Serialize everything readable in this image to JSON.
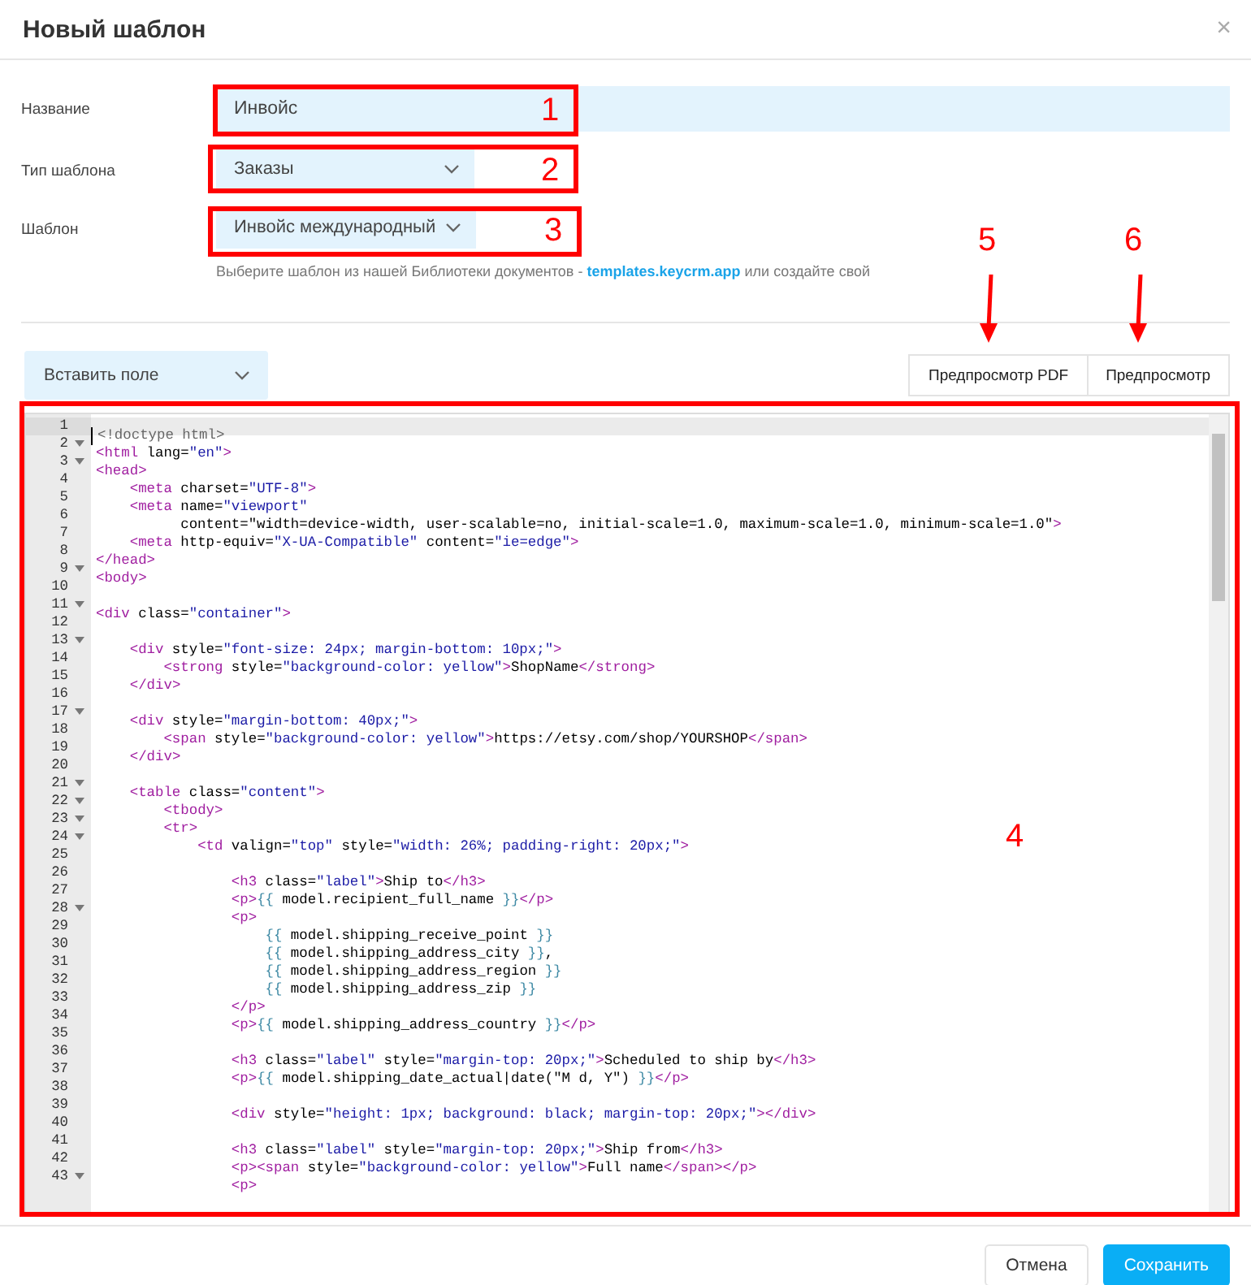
{
  "dialog": {
    "title": "Новый шаблон",
    "close": "×"
  },
  "fields": [
    {
      "kind": "text",
      "label": "Название",
      "value": "Инвойс"
    },
    {
      "kind": "select",
      "label": "Тип шаблона",
      "value": "Заказы"
    },
    {
      "kind": "select",
      "label": "Шаблон",
      "value": "Инвойс международный",
      "hint": "Выберите шаблон из нашей Библиотеки документов - ",
      "hint_link": "templates.keycrm.app",
      "hint_end": " или создайте свой"
    }
  ],
  "insert_field": "Вставить поле",
  "preview_buttons": [
    "Предпросмотр PDF",
    "Предпросмотр"
  ],
  "editor": {
    "lines": [
      {
        "number": "1",
        "text": "<!doctype html>",
        "foldable": false,
        "selected": true
      },
      {
        "number": "2",
        "text": "<html lang=\"en\">",
        "foldable": true,
        "selected": false
      },
      {
        "number": "3",
        "text": "<head>",
        "foldable": true,
        "selected": false
      },
      {
        "number": "4",
        "text": "    <meta charset=\"UTF-8\">",
        "foldable": false,
        "selected": false
      },
      {
        "number": "5",
        "text": "    <meta name=\"viewport\"",
        "foldable": false,
        "selected": false
      },
      {
        "number": "6",
        "text": "          content=\"width=device-width, user-scalable=no, initial-scale=1.0, maximum-scale=1.0, minimum-scale=1.0\">",
        "foldable": false,
        "selected": false
      },
      {
        "number": "7",
        "text": "    <meta http-equiv=\"X-UA-Compatible\" content=\"ie=edge\">",
        "foldable": false,
        "selected": false
      },
      {
        "number": "8",
        "text": "</head>",
        "foldable": false,
        "selected": false
      },
      {
        "number": "9",
        "text": "<body>",
        "foldable": true,
        "selected": false
      },
      {
        "number": "10",
        "foldable": false,
        "selected": false
      },
      {
        "number": "11",
        "text": "<div class=\"container\">",
        "foldable": true,
        "selected": false
      },
      {
        "number": "12",
        "foldable": false,
        "selected": false
      },
      {
        "number": "13",
        "text": "    <div style=\"font-size: 24px; margin-bottom: 10px;\">",
        "foldable": true,
        "selected": false
      },
      {
        "number": "14",
        "text": "        <strong style=\"background-color: yellow\">ShopName</strong>",
        "foldable": false,
        "selected": false
      },
      {
        "number": "15",
        "text": "    </div>",
        "foldable": false,
        "selected": false
      },
      {
        "number": "16",
        "foldable": false,
        "selected": false
      },
      {
        "number": "17",
        "text": "    <div style=\"margin-bottom: 40px;\">",
        "foldable": true,
        "selected": false
      },
      {
        "number": "18",
        "text": "        <span style=\"background-color: yellow\">https://etsy.com/shop/YOURSHOP</span>",
        "foldable": false,
        "selected": false
      },
      {
        "number": "19",
        "text": "    </div>",
        "foldable": false,
        "selected": false
      },
      {
        "number": "20",
        "foldable": false,
        "selected": false
      },
      {
        "number": "21",
        "text": "    <table class=\"content\">",
        "foldable": true,
        "selected": false
      },
      {
        "number": "22",
        "text": "        <tbody>",
        "foldable": true,
        "selected": false
      },
      {
        "number": "23",
        "text": "        <tr>",
        "foldable": true,
        "selected": false
      },
      {
        "number": "24",
        "text": "            <td valign=\"top\" style=\"width: 26%; padding-right: 20px;\">",
        "foldable": true,
        "selected": false
      },
      {
        "number": "25",
        "foldable": false,
        "selected": false
      },
      {
        "number": "26",
        "text": "                <h3 class=\"label\">Ship to</h3>",
        "foldable": false,
        "selected": false
      },
      {
        "number": "27",
        "text": "                <p>{{ model.recipient_full_name }}</p>",
        "foldable": false,
        "selected": false
      },
      {
        "number": "28",
        "text": "                <p>",
        "foldable": true,
        "selected": false
      },
      {
        "number": "29",
        "text": "                    {{ model.shipping_receive_point }}",
        "foldable": false,
        "selected": false
      },
      {
        "number": "30",
        "text": "                    {{ model.shipping_address_city }},",
        "foldable": false,
        "selected": false
      },
      {
        "number": "31",
        "text": "                    {{ model.shipping_address_region }}",
        "foldable": false,
        "selected": false
      },
      {
        "number": "32",
        "text": "                    {{ model.shipping_address_zip }}",
        "foldable": false,
        "selected": false
      },
      {
        "number": "33",
        "text": "                </p>",
        "foldable": false,
        "selected": false
      },
      {
        "number": "34",
        "text": "                <p>{{ model.shipping_address_country }}</p>",
        "foldable": false,
        "selected": false
      },
      {
        "number": "35",
        "foldable": false,
        "selected": false
      },
      {
        "number": "36",
        "text": "                <h3 class=\"label\" style=\"margin-top: 20px;\">Scheduled to ship by</h3>",
        "foldable": false,
        "selected": false
      },
      {
        "number": "37",
        "text": "                <p>{{ model.shipping_date_actual|date(\"M d, Y\") }}</p>",
        "foldable": false,
        "selected": false
      },
      {
        "number": "38",
        "foldable": false,
        "selected": false
      },
      {
        "number": "39",
        "text": "                <div style=\"height: 1px; background: black; margin-top: 20px;\"></div>",
        "foldable": false,
        "selected": false
      },
      {
        "number": "40",
        "foldable": false,
        "selected": false
      },
      {
        "number": "41",
        "text": "                <h3 class=\"label\" style=\"margin-top: 20px;\">Ship from</h3>",
        "foldable": false,
        "selected": false
      },
      {
        "number": "42",
        "text": "                <p><span style=\"background-color: yellow\">Full name</span></p>",
        "foldable": false,
        "selected": false
      },
      {
        "number": "43",
        "text": "                <p>",
        "foldable": true,
        "selected": false
      }
    ]
  },
  "footer_buttons": [
    {
      "label": "Отмена",
      "kind": "secondary"
    },
    {
      "label": "Сохранить",
      "kind": "primary"
    }
  ],
  "annotations": [
    {
      "label": "1",
      "kind": "box"
    },
    {
      "label": "2",
      "kind": "box"
    },
    {
      "label": "3",
      "kind": "box"
    },
    {
      "label": "4",
      "kind": "box"
    },
    {
      "label": "5",
      "kind": "arrow"
    },
    {
      "label": "6",
      "kind": "arrow"
    }
  ]
}
